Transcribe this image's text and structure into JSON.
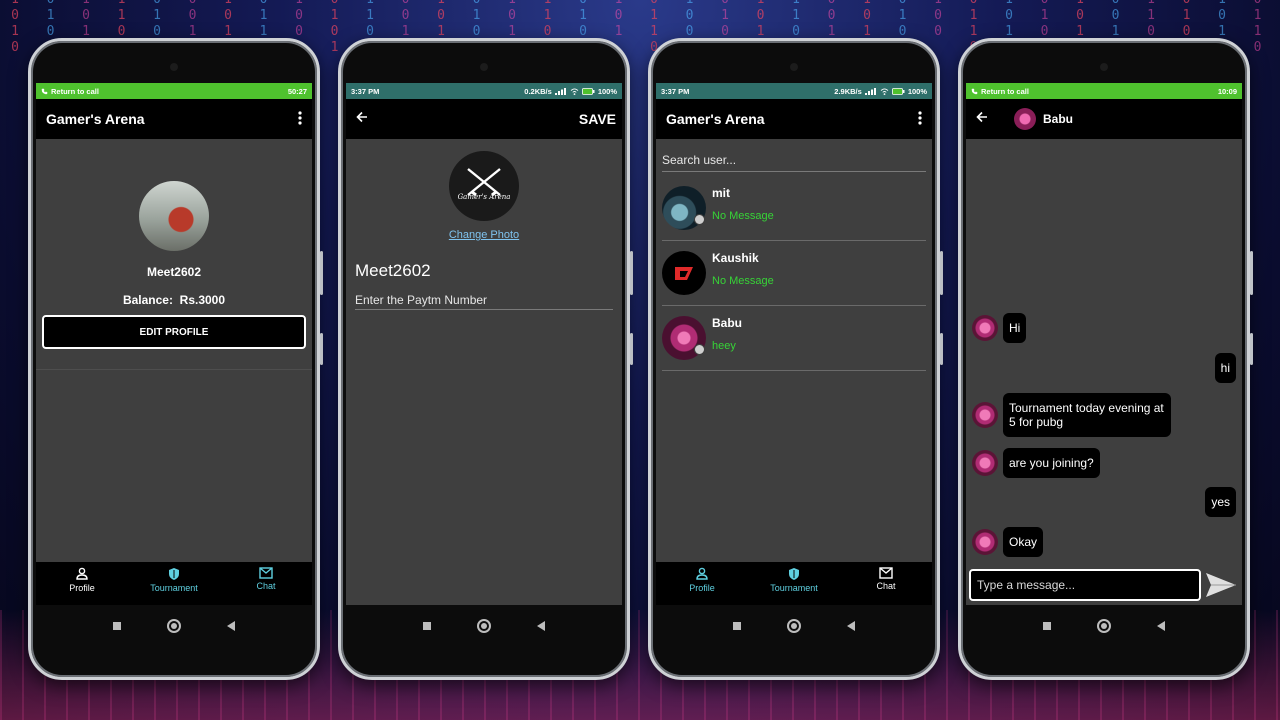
{
  "background": {
    "columns": [
      "1\n0\n1\n0",
      "0\n1\n0\n1",
      "1\n0\n1",
      "1\n1\n0\n1",
      "0\n1\n0",
      "0\n0\n1\n1",
      "1\n0\n1\n0",
      "0\n1\n1",
      "1\n0\n0\n1",
      "0\n1\n0\n1",
      "1\n1\n0",
      "0\n0\n1\n0",
      "1\n0\n1\n1",
      "0\n1\n0",
      "1\n0\n1\n0",
      "1\n1\n0\n1",
      "0\n1\n0\n0",
      "1\n0\n1",
      "0\n1\n1\n0",
      "1\n0\n0",
      "0\n1\n0\n1",
      "1\n0\n1\n0",
      "1\n1\n0",
      "0\n0\n1\n1",
      "1\n0\n1\n0",
      "0\n1\n0\n1",
      "1\n0\n0",
      "0\n1\n1\n0",
      "1\n0\n1\n0",
      "0\n1\n0",
      "1\n0\n1\n1",
      "0\n0\n1\n0",
      "1\n1\n0\n1",
      "0\n1\n0\n0",
      "1\n0\n1\n0",
      "0\n1\n1\n0"
    ]
  },
  "screen1": {
    "statusbar": {
      "left": "Return to call",
      "right": "50:27"
    },
    "appbar_title": "Gamer's Arena",
    "username": "Meet2602",
    "balance_label": "Balance:",
    "balance_value": "Rs.3000",
    "edit_button": "EDIT PROFILE",
    "nav": {
      "profile": "Profile",
      "tournament": "Tournament",
      "chat": "Chat"
    }
  },
  "screen2": {
    "statusbar": {
      "time": "3:37 PM",
      "net": "0.2KB/s",
      "battery": "100%"
    },
    "save_label": "SAVE",
    "logo_text": "Gamer's Arena",
    "change_photo": "Change Photo",
    "username": "Meet2602",
    "paytm_label": "Enter the Paytm Number"
  },
  "screen3": {
    "statusbar": {
      "time": "3:37 PM",
      "net": "2.9KB/s",
      "battery": "100%"
    },
    "appbar_title": "Gamer's Arena",
    "search_placeholder": "Search user...",
    "users": [
      {
        "name": "mit",
        "message": "No Message"
      },
      {
        "name": "Kaushik",
        "message": "No Message"
      },
      {
        "name": "Babu",
        "message": "heey"
      }
    ],
    "nav": {
      "profile": "Profile",
      "tournament": "Tournament",
      "chat": "Chat"
    }
  },
  "screen4": {
    "statusbar": {
      "left": "Return to call",
      "right": "10:09"
    },
    "contact_name": "Babu",
    "messages": [
      {
        "side": "left",
        "text": "Hi"
      },
      {
        "side": "right",
        "text": "hi"
      },
      {
        "side": "left",
        "text": "Tournament today evening at 5 for pubg"
      },
      {
        "side": "left",
        "text": "are you joining?"
      },
      {
        "side": "right",
        "text": "yes"
      },
      {
        "side": "left",
        "text": "Okay"
      }
    ],
    "composer_placeholder": "Type a message..."
  },
  "colors": {
    "status_green": "#4fc22e",
    "status_teal": "#2f6f6a",
    "accent_cyan": "#5fd0e0",
    "online_green": "#37d337",
    "link_blue": "#7fc3ef"
  },
  "icons": {
    "menu": "more-vert-icon",
    "back": "arrow-back-icon",
    "profile": "person-icon",
    "tournament": "shield-icon",
    "chat": "mail-icon",
    "send": "send-icon"
  }
}
